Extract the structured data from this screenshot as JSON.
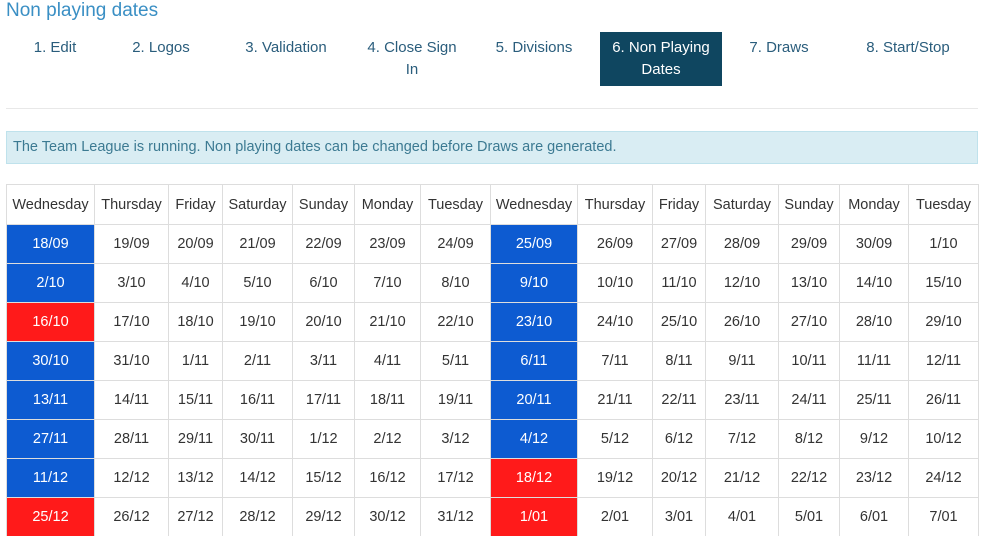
{
  "page": {
    "title": "Non playing dates"
  },
  "colors": {
    "accent": "#3a8fc4",
    "active_tab": "#0f4660",
    "play_blue": "#0d5bd1",
    "nonplay_red": "#ff1a1a",
    "alert_bg": "#d9edf3"
  },
  "tabs": [
    {
      "label": "1. Edit",
      "active": false
    },
    {
      "label": "2. Logos",
      "active": false
    },
    {
      "label": "3. Validation",
      "active": false
    },
    {
      "label": "4. Close Sign In",
      "active": false
    },
    {
      "label": "5. Divisions",
      "active": false
    },
    {
      "label": "6. Non Playing Dates",
      "active": true
    },
    {
      "label": "7. Draws",
      "active": false
    },
    {
      "label": "8. Start/Stop",
      "active": false
    }
  ],
  "alert": {
    "text": "The Team League is running. Non playing dates can be changed before Draws are generated."
  },
  "calendar": {
    "headers": [
      "Wednesday",
      "Thursday",
      "Friday",
      "Saturday",
      "Sunday",
      "Monday",
      "Tuesday",
      "Wednesday",
      "Thursday",
      "Friday",
      "Saturday",
      "Sunday",
      "Monday",
      "Tuesday"
    ],
    "rows": [
      [
        {
          "d": "18/09",
          "s": "blue"
        },
        {
          "d": "19/09"
        },
        {
          "d": "20/09"
        },
        {
          "d": "21/09"
        },
        {
          "d": "22/09"
        },
        {
          "d": "23/09"
        },
        {
          "d": "24/09"
        },
        {
          "d": "25/09",
          "s": "blue"
        },
        {
          "d": "26/09"
        },
        {
          "d": "27/09"
        },
        {
          "d": "28/09"
        },
        {
          "d": "29/09"
        },
        {
          "d": "30/09"
        },
        {
          "d": "1/10"
        }
      ],
      [
        {
          "d": "2/10",
          "s": "blue"
        },
        {
          "d": "3/10"
        },
        {
          "d": "4/10"
        },
        {
          "d": "5/10"
        },
        {
          "d": "6/10"
        },
        {
          "d": "7/10"
        },
        {
          "d": "8/10"
        },
        {
          "d": "9/10",
          "s": "blue"
        },
        {
          "d": "10/10"
        },
        {
          "d": "11/10"
        },
        {
          "d": "12/10"
        },
        {
          "d": "13/10"
        },
        {
          "d": "14/10"
        },
        {
          "d": "15/10"
        }
      ],
      [
        {
          "d": "16/10",
          "s": "red"
        },
        {
          "d": "17/10"
        },
        {
          "d": "18/10"
        },
        {
          "d": "19/10"
        },
        {
          "d": "20/10"
        },
        {
          "d": "21/10"
        },
        {
          "d": "22/10"
        },
        {
          "d": "23/10",
          "s": "blue"
        },
        {
          "d": "24/10"
        },
        {
          "d": "25/10"
        },
        {
          "d": "26/10"
        },
        {
          "d": "27/10"
        },
        {
          "d": "28/10"
        },
        {
          "d": "29/10"
        }
      ],
      [
        {
          "d": "30/10",
          "s": "blue"
        },
        {
          "d": "31/10"
        },
        {
          "d": "1/11"
        },
        {
          "d": "2/11"
        },
        {
          "d": "3/11"
        },
        {
          "d": "4/11"
        },
        {
          "d": "5/11"
        },
        {
          "d": "6/11",
          "s": "blue"
        },
        {
          "d": "7/11"
        },
        {
          "d": "8/11"
        },
        {
          "d": "9/11"
        },
        {
          "d": "10/11"
        },
        {
          "d": "11/11"
        },
        {
          "d": "12/11"
        }
      ],
      [
        {
          "d": "13/11",
          "s": "blue"
        },
        {
          "d": "14/11"
        },
        {
          "d": "15/11"
        },
        {
          "d": "16/11"
        },
        {
          "d": "17/11"
        },
        {
          "d": "18/11"
        },
        {
          "d": "19/11"
        },
        {
          "d": "20/11",
          "s": "blue"
        },
        {
          "d": "21/11"
        },
        {
          "d": "22/11"
        },
        {
          "d": "23/11"
        },
        {
          "d": "24/11"
        },
        {
          "d": "25/11"
        },
        {
          "d": "26/11"
        }
      ],
      [
        {
          "d": "27/11",
          "s": "blue"
        },
        {
          "d": "28/11"
        },
        {
          "d": "29/11"
        },
        {
          "d": "30/11"
        },
        {
          "d": "1/12"
        },
        {
          "d": "2/12"
        },
        {
          "d": "3/12"
        },
        {
          "d": "4/12",
          "s": "blue"
        },
        {
          "d": "5/12"
        },
        {
          "d": "6/12"
        },
        {
          "d": "7/12"
        },
        {
          "d": "8/12"
        },
        {
          "d": "9/12"
        },
        {
          "d": "10/12"
        }
      ],
      [
        {
          "d": "11/12",
          "s": "blue"
        },
        {
          "d": "12/12"
        },
        {
          "d": "13/12"
        },
        {
          "d": "14/12"
        },
        {
          "d": "15/12"
        },
        {
          "d": "16/12"
        },
        {
          "d": "17/12"
        },
        {
          "d": "18/12",
          "s": "red"
        },
        {
          "d": "19/12"
        },
        {
          "d": "20/12"
        },
        {
          "d": "21/12"
        },
        {
          "d": "22/12"
        },
        {
          "d": "23/12"
        },
        {
          "d": "24/12"
        }
      ],
      [
        {
          "d": "25/12",
          "s": "red"
        },
        {
          "d": "26/12"
        },
        {
          "d": "27/12"
        },
        {
          "d": "28/12"
        },
        {
          "d": "29/12"
        },
        {
          "d": "30/12"
        },
        {
          "d": "31/12"
        },
        {
          "d": "1/01",
          "s": "red"
        },
        {
          "d": "2/01"
        },
        {
          "d": "3/01"
        },
        {
          "d": "4/01"
        },
        {
          "d": "5/01"
        },
        {
          "d": "6/01"
        },
        {
          "d": "7/01"
        }
      ]
    ]
  }
}
